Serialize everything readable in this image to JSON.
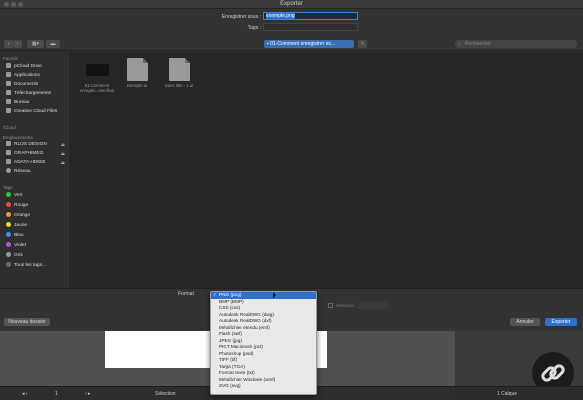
{
  "window": {
    "title": "Exporter"
  },
  "save": {
    "name_label": "Enregistrer sous :",
    "name_value": "exemple.png",
    "tags_label": "Tags :"
  },
  "toolbar": {
    "location": "01-Comment enregistrer so...",
    "search_placeholder": "Rechercher"
  },
  "sidebar": {
    "favorites_header": "Favoris",
    "favorites": [
      "pCloud Drive",
      "Applications",
      "Documents",
      "Téléchargements",
      "Bureau",
      "Creative Cloud Files"
    ],
    "icloud_header": "iCloud",
    "locations_header": "Emplacements",
    "locations": [
      "RLOS DESIGN",
      "GRAPHIMEO",
      "ADATA HD650",
      "Réseau"
    ],
    "tags_header": "Tags",
    "tags": [
      {
        "label": "Vert",
        "color": "#35c04a"
      },
      {
        "label": "Rouge",
        "color": "#ee4b4b"
      },
      {
        "label": "Orange",
        "color": "#f39a2b"
      },
      {
        "label": "Jaune",
        "color": "#f2d230"
      },
      {
        "label": "Bleu",
        "color": "#3b8ff2"
      },
      {
        "label": "Violet",
        "color": "#b25ad9"
      },
      {
        "label": "Gris",
        "color": "#9a9a9a"
      },
      {
        "label": "Tous les tags...",
        "color": "#6a6a6a"
      }
    ]
  },
  "files": [
    {
      "line1": "01-Comment",
      "line2": "enregist...reenflow"
    },
    {
      "line1": "exemple.ai",
      "line2": ""
    },
    {
      "line1": "Sans titre - 1.ai",
      "line2": ""
    }
  ],
  "options": {
    "format_label": "Format",
    "selection_label": "Sélection"
  },
  "format_menu": {
    "selected": "PNG (png)",
    "items": [
      "PNG (png)",
      "BMP (BMP)",
      "CSS (css)",
      "Autodesk RealDWG (dwg)",
      "Autodesk RealDWG (dxf)",
      "Métafichier étendu (emf)",
      "Flash (swf)",
      "JPEG (jpg)",
      "PICT Macintosh (pct)",
      "Photoshop (psd)",
      "TIFF (tif)",
      "Targa (TGA)",
      "Format texte (txt)",
      "Métafichier Windows (wmf)",
      "SVG (svg)"
    ]
  },
  "buttons": {
    "new_folder": "Nouveau dossier",
    "cancel": "Annuler",
    "export": "Exporter"
  },
  "statusbar": {
    "page": "1",
    "mode": "Sélection",
    "layers": "1 Calque"
  }
}
